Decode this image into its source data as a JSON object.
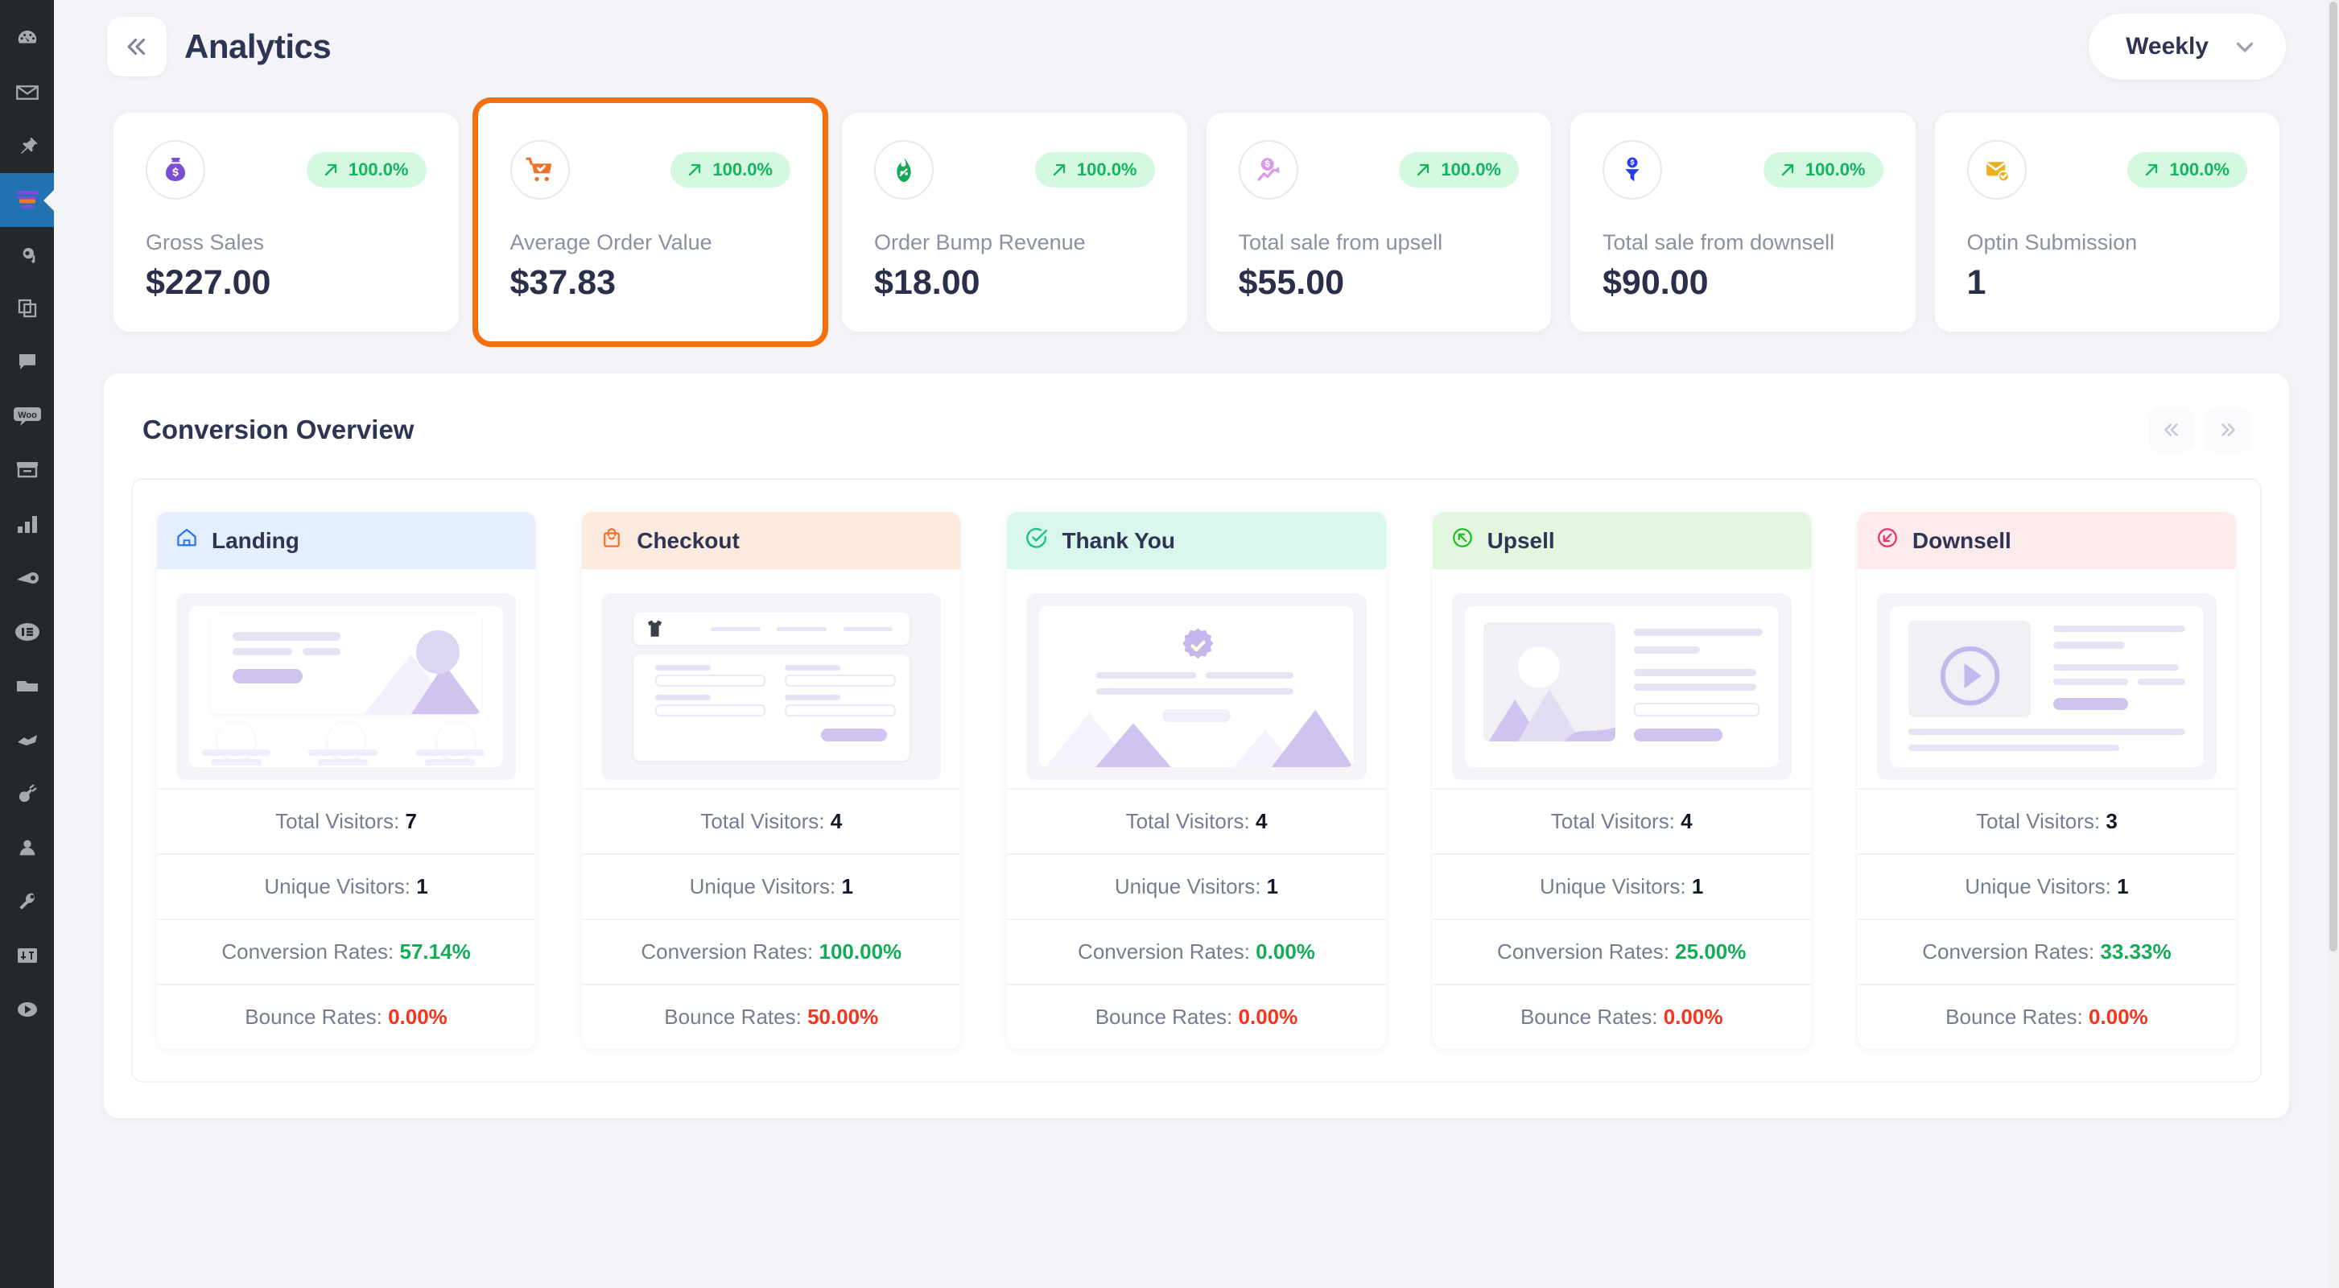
{
  "sidebar": {
    "items": [
      {
        "name": "dashboard-icon",
        "label": "Dashboard",
        "active": false
      },
      {
        "name": "mail-icon",
        "label": "Mail",
        "active": false
      },
      {
        "name": "pin-icon",
        "label": "Posts",
        "active": false
      },
      {
        "name": "funnel-icon",
        "label": "Funnels",
        "active": true
      },
      {
        "name": "media-icon",
        "label": "Media",
        "active": false
      },
      {
        "name": "pages-icon",
        "label": "Pages",
        "active": false
      },
      {
        "name": "comments-icon",
        "label": "Comments",
        "active": false
      },
      {
        "name": "woo-icon",
        "label": "WooCommerce",
        "active": false
      },
      {
        "name": "products-icon",
        "label": "Products",
        "active": false
      },
      {
        "name": "analytics-bar-icon",
        "label": "Analytics",
        "active": false
      },
      {
        "name": "marketing-icon",
        "label": "Marketing",
        "active": false
      },
      {
        "name": "elementor-icon",
        "label": "Elementor",
        "active": false
      },
      {
        "name": "templates-icon",
        "label": "Templates",
        "active": false
      },
      {
        "name": "appearance-icon",
        "label": "Appearance",
        "active": false
      },
      {
        "name": "plugins-icon",
        "label": "Plugins",
        "active": false
      },
      {
        "name": "users-icon",
        "label": "Users",
        "active": false
      },
      {
        "name": "tools-icon",
        "label": "Tools",
        "active": false
      },
      {
        "name": "settings-icon",
        "label": "Settings",
        "active": false
      },
      {
        "name": "collapse-menu-icon",
        "label": "Collapse menu",
        "active": false
      }
    ]
  },
  "header": {
    "collapse_icon": "chevron-double-left-icon",
    "title": "Analytics",
    "period": {
      "label": "Weekly",
      "chevron": "chevron-down-icon",
      "options": [
        "Weekly"
      ]
    }
  },
  "stats": {
    "trend_arrow": "arrow-up-right-icon",
    "cards": [
      {
        "icon": "money-bag-icon",
        "badge": "100.0%",
        "label": "Gross Sales",
        "value": "$227.00",
        "selected": false
      },
      {
        "icon": "shopping-cart-check-icon",
        "badge": "100.0%",
        "label": "Average Order Value",
        "value": "$37.83",
        "selected": true
      },
      {
        "icon": "percent-fire-icon",
        "badge": "100.0%",
        "label": "Order Bump Revenue",
        "value": "$18.00",
        "selected": false
      },
      {
        "icon": "upsell-coin-chart-icon",
        "badge": "100.0%",
        "label": "Total sale from upsell",
        "value": "$55.00",
        "selected": false
      },
      {
        "icon": "downsell-funnel-coin-icon",
        "badge": "100.0%",
        "label": "Total sale from downsell",
        "value": "$90.00",
        "selected": false
      },
      {
        "icon": "envelope-check-icon",
        "badge": "100.0%",
        "label": "Optin Submission",
        "value": "1",
        "selected": false
      }
    ]
  },
  "conversion": {
    "title": "Conversion Overview",
    "nav": {
      "prev_icon": "chevron-double-left-icon",
      "next_icon": "chevron-double-right-icon"
    },
    "stat_labels": {
      "total_visitors": "Total Visitors:",
      "unique_visitors": "Unique Visitors:",
      "conversion_rates": "Conversion Rates:",
      "bounce_rates": "Bounce Rates:"
    },
    "steps": [
      {
        "id": "landing",
        "title": "Landing",
        "icon": "home-icon",
        "head_bg": "#e4eefd",
        "icon_color": "#2476f2",
        "total_visitors": "7",
        "unique_visitors": "1",
        "conversion_rate": "57.14%",
        "bounce_rate": "0.00%"
      },
      {
        "id": "checkout",
        "title": "Checkout",
        "icon": "shopping-bag-icon",
        "head_bg": "#fdeade",
        "icon_color": "#f0722a",
        "total_visitors": "4",
        "unique_visitors": "1",
        "conversion_rate": "100.00%",
        "bounce_rate": "50.00%"
      },
      {
        "id": "thank-you",
        "title": "Thank You",
        "icon": "check-circle-icon",
        "head_bg": "#d9f7ec",
        "icon_color": "#17c38a",
        "total_visitors": "4",
        "unique_visitors": "1",
        "conversion_rate": "0.00%",
        "bounce_rate": "0.00%"
      },
      {
        "id": "upsell",
        "title": "Upsell",
        "icon": "arrow-up-left-circle-icon",
        "head_bg": "#e3f7e0",
        "icon_color": "#1fbd1f",
        "total_visitors": "4",
        "unique_visitors": "1",
        "conversion_rate": "25.00%",
        "bounce_rate": "0.00%"
      },
      {
        "id": "downsell",
        "title": "Downsell",
        "icon": "arrow-down-left-circle-icon",
        "head_bg": "#fdeaea",
        "icon_color": "#e8336b",
        "total_visitors": "3",
        "unique_visitors": "1",
        "conversion_rate": "33.33%",
        "bounce_rate": "0.00%"
      }
    ]
  },
  "colors": {
    "accent_orange": "#f4700c",
    "page_bg": "#f4f4f8",
    "text_dark": "#2e3453",
    "text_muted": "#8b90a3",
    "positive": "#13ad58",
    "negative": "#f5361f",
    "badge_bg": "#d5f8e0"
  }
}
